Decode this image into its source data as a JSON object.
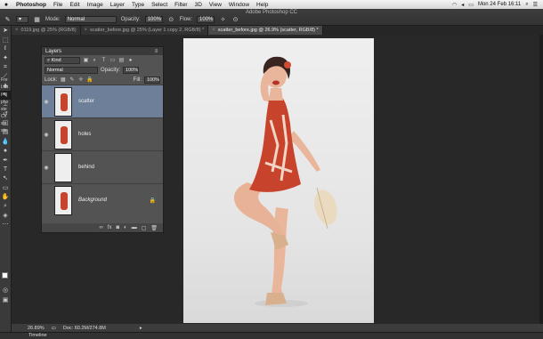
{
  "menubar": {
    "apple": "",
    "app": "Photoshop",
    "items": [
      "File",
      "Edit",
      "Image",
      "Layer",
      "Type",
      "Select",
      "Filter",
      "3D",
      "View",
      "Window",
      "Help"
    ],
    "clock": "Mon 24 Feb  16:11"
  },
  "window_title": "Adobe Photoshop CC",
  "options": {
    "mode_label": "Mode:",
    "mode_value": "Normal",
    "opacity_label": "Opacity:",
    "opacity_value": "100%",
    "flow_label": "Flow:",
    "flow_value": "100%",
    "workspace": "3D"
  },
  "doc_tabs": [
    {
      "label": "0119.jpg @ 25% (RGB/8)",
      "active": false
    },
    {
      "label": "scatter_before.jpg @ 25% (Layer 1 copy 2, RGB/8) *",
      "active": false
    },
    {
      "label": "scatter_before.jpg @ 26.9% (scatter, RGB/8) *",
      "active": true
    }
  ],
  "stray_text": [
    "Fre",
    "Lea",
    "per",
    "pho",
    "ste",
    "Cli",
    "ste",
    "ste"
  ],
  "layers_panel": {
    "tab": "Layers",
    "filter_value": "Kind",
    "blend_mode": "Normal",
    "opacity_label": "Opacity:",
    "opacity_value": "100%",
    "lock_label": "Lock:",
    "fill_label": "Fill:",
    "fill_value": "100%",
    "layers": [
      {
        "name": "scatter",
        "selected": true
      },
      {
        "name": "holes",
        "selected": false
      },
      {
        "name": "behind",
        "selected": false
      },
      {
        "name": "Background",
        "selected": false
      }
    ]
  },
  "status": {
    "zoom": "26.89%",
    "doc": "Doc: 60.2M/274.8M"
  },
  "timeline": "Timeline"
}
